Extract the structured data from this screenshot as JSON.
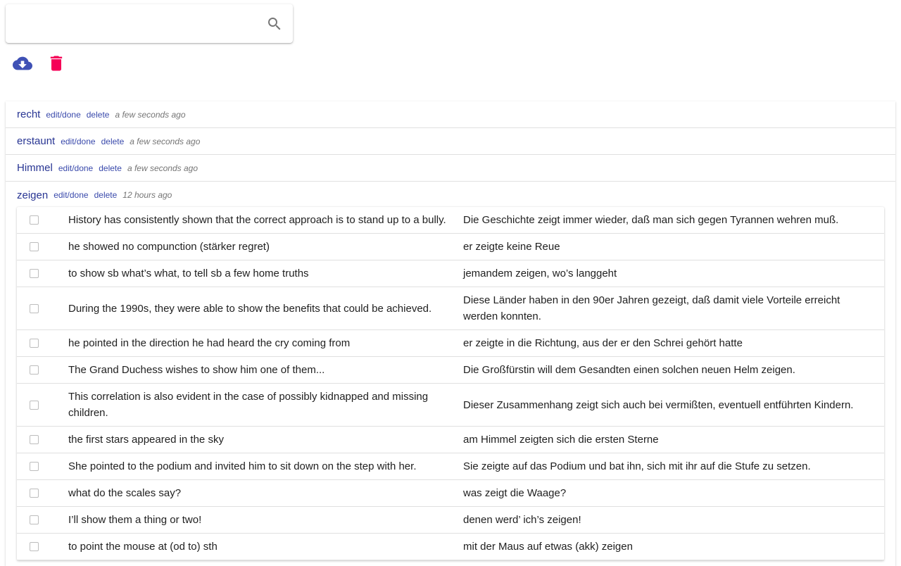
{
  "search": {
    "placeholder": "",
    "value": "",
    "icon": "search-icon"
  },
  "toolbar": {
    "download_icon": "cloud-download-icon",
    "delete_icon": "trash-icon",
    "download_color": "#3f51b5",
    "delete_color": "#f50057"
  },
  "words": [
    {
      "word": "recht",
      "edit_label": "edit/done",
      "delete_label": "delete",
      "time": "a few seconds ago"
    },
    {
      "word": "erstaunt",
      "edit_label": "edit/done",
      "delete_label": "delete",
      "time": "a few seconds ago"
    },
    {
      "word": "Himmel",
      "edit_label": "edit/done",
      "delete_label": "delete",
      "time": "a few seconds ago"
    },
    {
      "word": "zeigen",
      "edit_label": "edit/done",
      "delete_label": "delete",
      "time": "12 hours ago"
    }
  ],
  "examples": [
    {
      "en": "History has consistently shown that the correct approach is to stand up to a bully.",
      "de": "Die Geschichte zeigt immer wieder, daß man sich gegen Tyrannen wehren muß."
    },
    {
      "en": "he showed no compunction (stärker regret)",
      "de": "er zeigte keine Reue"
    },
    {
      "en": "to show sb what’s what, to tell sb a few home truths",
      "de": "jemandem zeigen, wo’s langgeht"
    },
    {
      "en": "During the 1990s, they were able to show the benefits that could be achieved.",
      "de": "Diese Länder haben in den 90er Jahren gezeigt, daß damit viele Vorteile erreicht werden konnten."
    },
    {
      "en": "he pointed in the direction he had heard the cry coming from",
      "de": "er zeigte in die Richtung, aus der er den Schrei gehört hatte"
    },
    {
      "en": "The Grand Duchess wishes to show him one of them...",
      "de": "Die Großfürstin will dem Gesandten einen solchen neuen Helm zeigen."
    },
    {
      "en": "This correlation is also evident in the case of possibly kidnapped and missing children.",
      "de": "Dieser Zusammenhang zeigt sich auch bei vermißten, eventuell entführten Kindern."
    },
    {
      "en": "the first stars appeared in the sky",
      "de": "am Himmel zeigten sich die ersten Sterne"
    },
    {
      "en": "She pointed to the podium and invited him to sit down on the step with her.",
      "de": "Sie zeigte auf das Podium und bat ihn, sich mit ihr auf die Stufe zu setzen."
    },
    {
      "en": "what do the scales say?",
      "de": "was zeigt die Waage?"
    },
    {
      "en": "I’ll show them a thing or two!",
      "de": "denen werd’ ich’s zeigen!"
    },
    {
      "en": "to point the mouse at (od to) sth",
      "de": "mit der Maus auf etwas (akk) zeigen"
    }
  ]
}
